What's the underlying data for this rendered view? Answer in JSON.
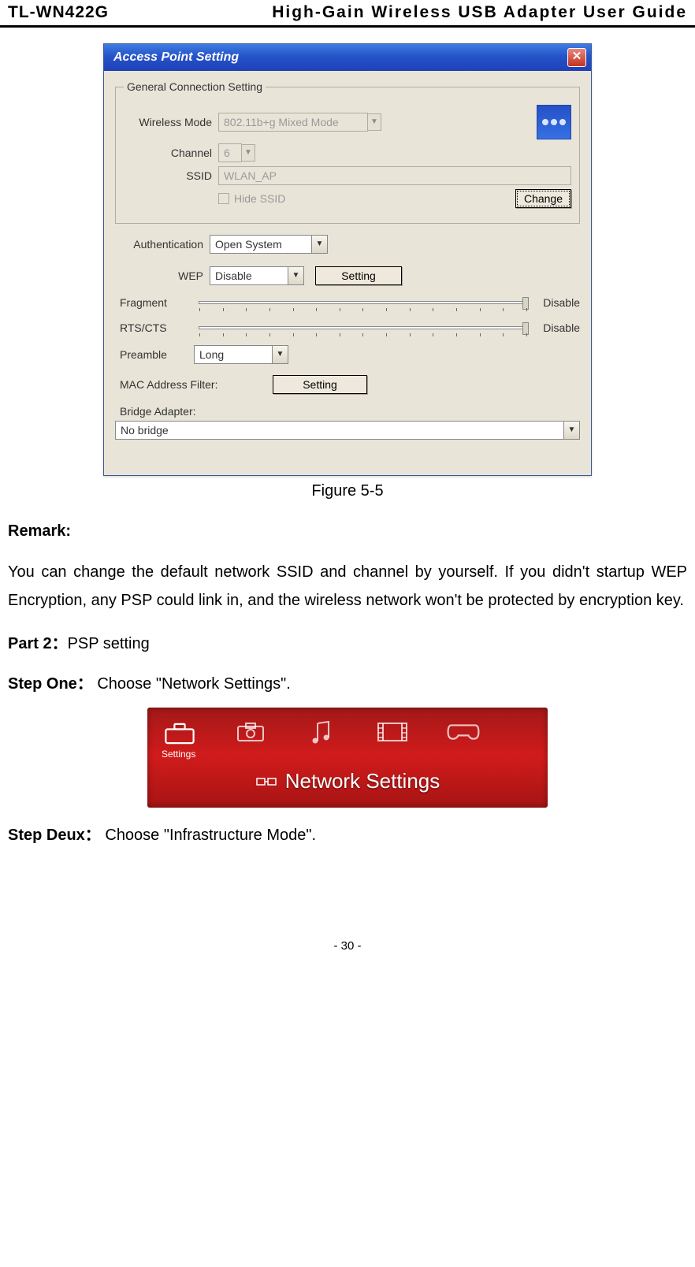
{
  "header": {
    "product": "TL-WN422G",
    "title": "High-Gain Wireless USB Adapter User Guide"
  },
  "dialog": {
    "title": "Access Point Setting",
    "fieldset_legend": "General Connection Setting",
    "labels": {
      "wireless_mode": "Wireless Mode",
      "channel": "Channel",
      "ssid": "SSID",
      "hide_ssid": "Hide SSID",
      "change": "Change",
      "authentication": "Authentication",
      "wep": "WEP",
      "setting": "Setting",
      "fragment": "Fragment",
      "rts_cts": "RTS/CTS",
      "preamble": "Preamble",
      "mac_filter": "MAC Address Filter:",
      "bridge": "Bridge Adapter:",
      "disable": "Disable"
    },
    "values": {
      "wireless_mode": "802.11b+g Mixed Mode",
      "channel": "6",
      "ssid": "WLAN_AP",
      "authentication": "Open System",
      "wep": "Disable",
      "preamble": "Long",
      "bridge": "No bridge"
    }
  },
  "caption": "Figure 5-5",
  "remark_label": "Remark:",
  "remark_body": "You can change the default network SSID and channel by yourself. If you didn't startup WEP Encryption, any PSP could link in, and the wireless network won't be protected by encryption key.",
  "part2_bold": "Part 2：",
  "part2_rest": "PSP setting",
  "step_one_bold": "Step One：",
  "step_one_rest": "  Choose \"Network Settings\".",
  "psp": {
    "settings_label": "Settings",
    "subtitle": "Network Settings"
  },
  "step_two_bold": "Step Deux：",
  "step_two_rest": " Choose \"Infrastructure Mode\".",
  "page_number": "30"
}
